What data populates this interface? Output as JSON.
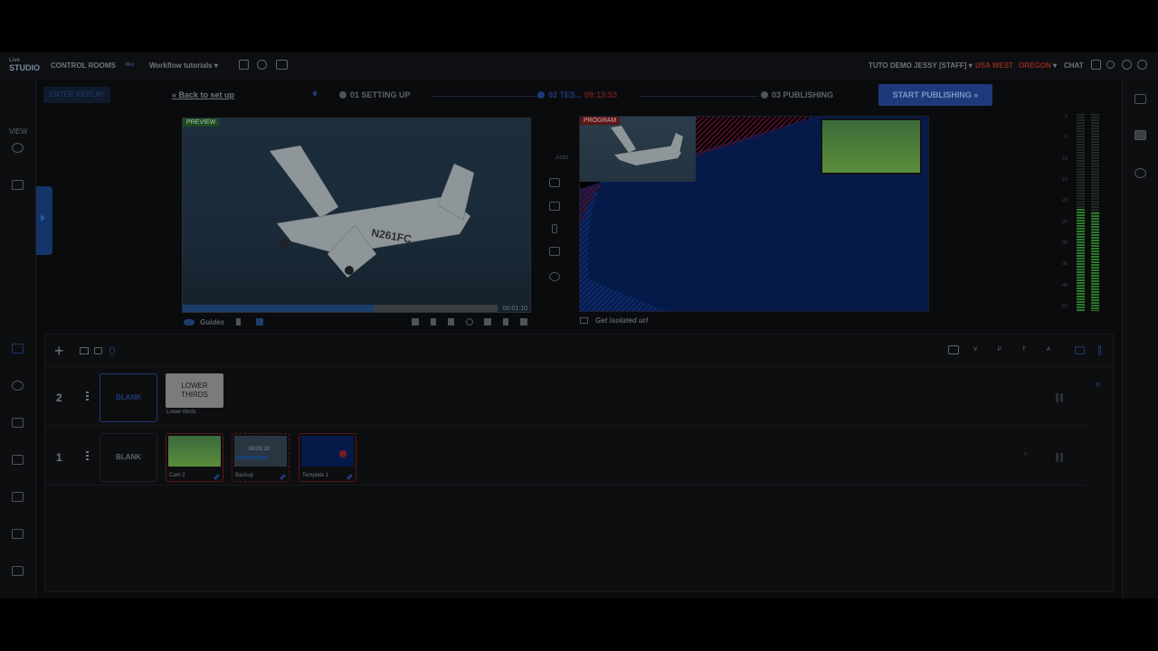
{
  "topbar": {
    "logo_top": "Live",
    "logo_main": "STUDIO",
    "control_rooms": "CONTROL ROOMS",
    "workspace_badge": "#ko",
    "workspace": "Workflow tutorials",
    "user": "TUTO DEMO JESSY [STAFF]",
    "region": "USA WEST",
    "region_sub": "OREGON",
    "chat": "CHAT"
  },
  "leftnav": {
    "view_label": "VIEW"
  },
  "steps": {
    "replay_button": "ENTER REPLAY",
    "back_link": "Back to set up",
    "step1": "01 SETTING UP",
    "step2": "02 TES...",
    "step2_timer": "09:13:53",
    "step3": "03 PUBLISHING",
    "publish_button": "START PUBLISHING"
  },
  "preview": {
    "badge": "PREVIEW",
    "timecode": "00:01:10",
    "progress_fraction": 0.61,
    "auto_label": "Auto",
    "guides_label": "Guides"
  },
  "program": {
    "badge": "PROGRAM",
    "isolated_label": "Get isolated url"
  },
  "vu": {
    "scale": [
      "0",
      "-5",
      "-10",
      "-15",
      "-20",
      "-25",
      "-30",
      "-35",
      "-40",
      "-60"
    ],
    "level_left": 0.52,
    "level_right": 0.5
  },
  "rundown": {
    "toolbar_letters": [
      "V",
      "P",
      "T",
      "A"
    ],
    "layers": [
      {
        "number": "2",
        "blank": "BLANK",
        "lower_thirds_line1": "LOWER",
        "lower_thirds_line2": "THIRDS",
        "lower_thirds_caption": "Lower thirds"
      },
      {
        "number": "1",
        "blank": "BLANK",
        "items": [
          {
            "caption": "Cam 2"
          },
          {
            "caption": "Backup",
            "timecode": "00:01:10"
          },
          {
            "caption": "Template 1"
          }
        ]
      }
    ],
    "add_label": "+",
    "close_label": "×"
  },
  "colors": {
    "accent": "#1e3a7a",
    "live_red": "#5a1717",
    "preview_green": "#1e4a22"
  }
}
